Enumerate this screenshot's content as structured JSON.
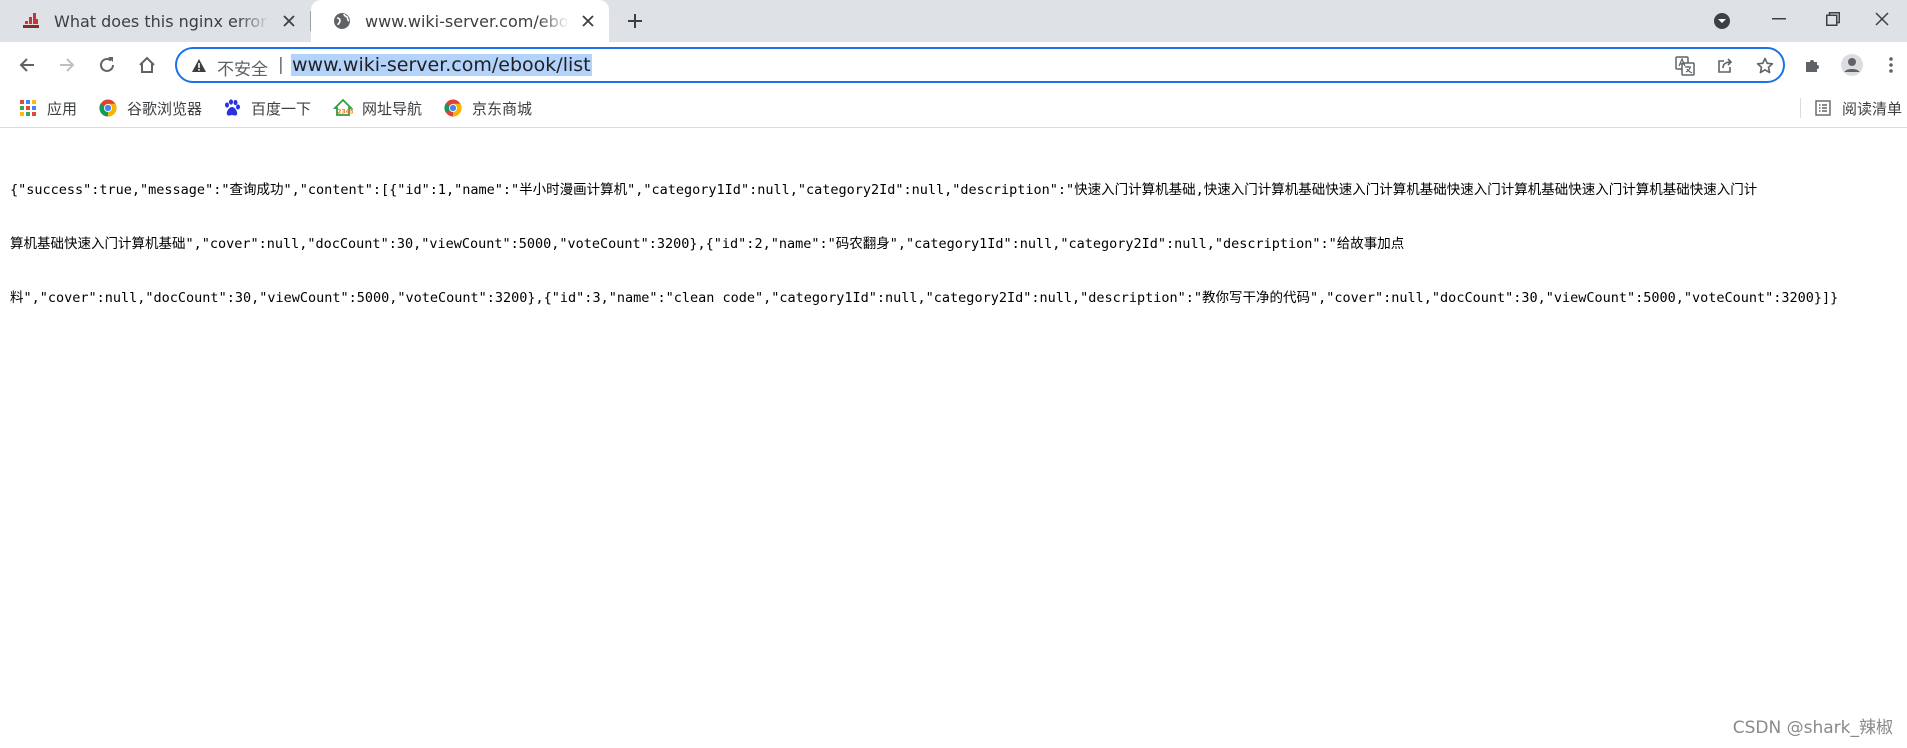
{
  "tabs": [
    {
      "title": "What does this nginx error \"rewrite or internal redirection cycle\" mean?",
      "favicon": "stackoverflow-icon",
      "active": false
    },
    {
      "title": "www.wiki-server.com/ebook/list",
      "favicon": "globe-icon",
      "active": true
    }
  ],
  "omnibox": {
    "security_label": "不安全",
    "divider": "|",
    "url": "www.wiki-server.com/ebook/list"
  },
  "bookmarks": [
    {
      "label": "应用",
      "icon": "apps-grid-icon"
    },
    {
      "label": "谷歌浏览器",
      "icon": "chrome-icon"
    },
    {
      "label": "百度一下",
      "icon": "baidu-paw-icon"
    },
    {
      "label": "网址导航",
      "icon": "2345-nav-icon"
    },
    {
      "label": "京东商城",
      "icon": "chrome-icon"
    }
  ],
  "reading_list_label": "阅读清单",
  "page": {
    "lines": [
      "{\"success\":true,\"message\":\"查询成功\",\"content\":[{\"id\":1,\"name\":\"半小时漫画计算机\",\"category1Id\":null,\"category2Id\":null,\"description\":\"快速入门计算机基础,快速入门计算机基础快速入门计算机基础快速入门计算机基础快速入门计算机基础快速入门计",
      "算机基础快速入门计算机基础\",\"cover\":null,\"docCount\":30,\"viewCount\":5000,\"voteCount\":3200},{\"id\":2,\"name\":\"码农翻身\",\"category1Id\":null,\"category2Id\":null,\"description\":\"给故事加点",
      "料\",\"cover\":null,\"docCount\":30,\"viewCount\":5000,\"voteCount\":3200},{\"id\":3,\"name\":\"clean code\",\"category1Id\":null,\"category2Id\":null,\"description\":\"教你写干净的代码\",\"cover\":null,\"docCount\":30,\"viewCount\":5000,\"voteCount\":3200}]}"
    ]
  },
  "watermark": "CSDN @shark_辣椒"
}
